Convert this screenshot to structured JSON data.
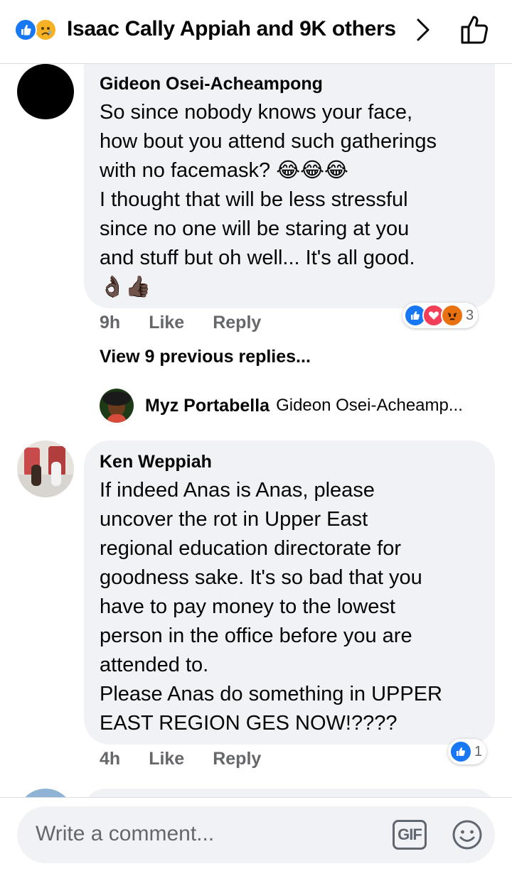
{
  "header": {
    "title": "Isaac Cally Appiah and 9K others",
    "reaction_icons": [
      "like-icon",
      "sad-icon"
    ],
    "chevron_icon": "chevron-right-icon",
    "like_button_icon": "thumbs-up-outline-icon"
  },
  "comments": [
    {
      "author": "Gideon Osei-Acheampong",
      "text": "So since nobody knows your face,\nhow bout you attend such gatherings\nwith no facemask? 😂😂😂\nI thought that will be less stressful\nsince no one will be staring at you\nand stuff but oh well... It's all good.\n👌🏿👍🏿",
      "time": "9h",
      "like_label": "Like",
      "reply_label": "Reply",
      "reactions": [
        "like",
        "love",
        "angry"
      ],
      "reaction_count": "3"
    },
    {
      "author": "Ken Weppiah",
      "text": "If indeed Anas is Anas, please\nuncover the rot in Upper East\nregional education directorate for\ngoodness sake. It's so bad that you\nhave to pay money to the lowest\nperson in the office before you are\nattended to.\nPlease Anas do something in UPPER\nEAST REGION GES NOW!????",
      "time": "4h",
      "like_label": "Like",
      "reply_label": "Reply",
      "reactions": [
        "like"
      ],
      "reaction_count": "1"
    }
  ],
  "replies_thread": {
    "view_previous": "View 9 previous replies...",
    "reply_author": "Myz Portabella",
    "reply_preview": "Gideon Osei-Acheamp..."
  },
  "composer": {
    "placeholder": "Write a comment...",
    "gif_label": "GIF",
    "emoji_icon": "smiley-icon"
  },
  "colors": {
    "like_blue": "#1877f2",
    "love_red": "#f33e58",
    "angry_orange": "#e9710f",
    "bubble_gray": "#f0f2f5",
    "meta_gray": "#65676b"
  }
}
